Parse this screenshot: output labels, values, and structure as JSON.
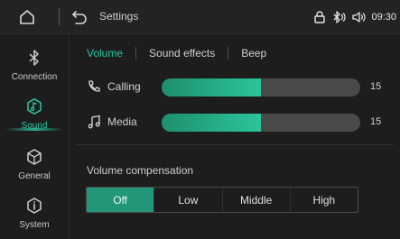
{
  "header": {
    "title": "Settings",
    "time": "09:30",
    "status_icons": [
      "lock-icon",
      "bluetooth-icon",
      "volume-icon"
    ]
  },
  "sidebar": {
    "items": [
      {
        "label": "Connection",
        "icon": "bluetooth-icon",
        "active": false
      },
      {
        "label": "Sound",
        "icon": "music-note-icon",
        "active": true
      },
      {
        "label": "General",
        "icon": "settings-cube-icon",
        "active": false
      },
      {
        "label": "System",
        "icon": "info-icon",
        "active": false
      }
    ]
  },
  "tabs": [
    {
      "label": "Volume",
      "active": true
    },
    {
      "label": "Sound effects",
      "active": false
    },
    {
      "label": "Beep",
      "active": false
    }
  ],
  "volume": [
    {
      "label": "Calling",
      "icon": "phone-icon",
      "value": "15",
      "fraction": 0.5
    },
    {
      "label": "Media",
      "icon": "music-note-icon",
      "value": "15",
      "fraction": 0.5
    }
  ],
  "compensation": {
    "label": "Volume compensation",
    "options": [
      "Off",
      "Low",
      "Middle",
      "High"
    ],
    "selected": "Off"
  },
  "colors": {
    "accent": "#29c6a0",
    "background": "#1d1d1d",
    "track": "#4a4a4a"
  }
}
